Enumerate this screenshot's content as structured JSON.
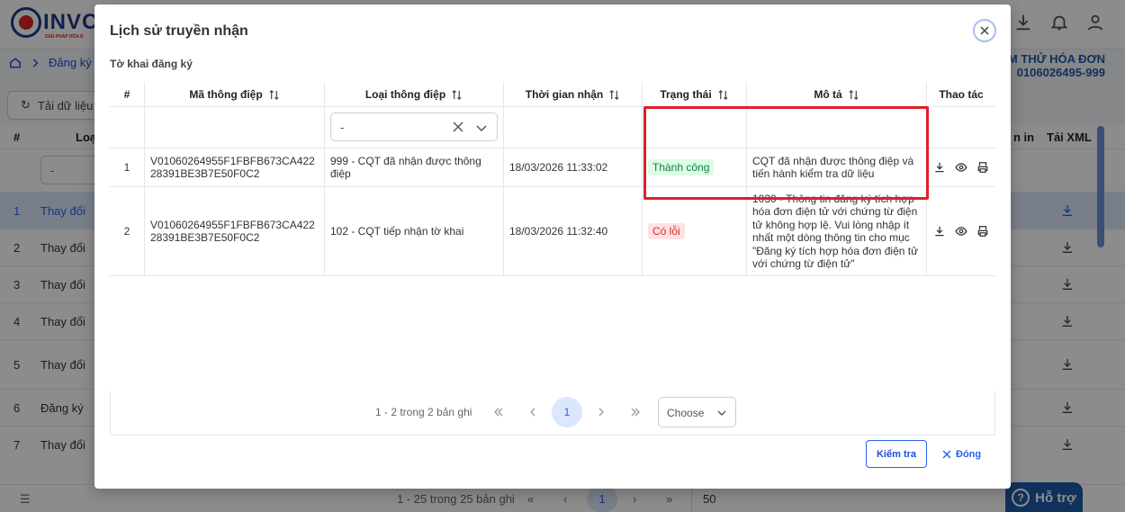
{
  "app": {
    "logo_text": "INVO",
    "logo_subtext": "GIẢI PHÁP HÓA Đ",
    "breadcrumb": "Đăng ký ph",
    "company_name": "ẾM THỬ HÓA ĐƠN",
    "company_tax": "0106026495-999",
    "reload_label": "Tải dữ liệu",
    "table_headers": {
      "index": "#",
      "type": "Loại",
      "receipt": "n in",
      "xml": "Tải XML"
    },
    "filter_placeholder": "-",
    "rows": [
      {
        "index": "1",
        "text": "Thay đổi"
      },
      {
        "index": "2",
        "text": "Thay đổi"
      },
      {
        "index": "3",
        "text": "Thay đổi"
      },
      {
        "index": "4",
        "text": "Thay đổi"
      },
      {
        "index": "5",
        "text": "Thay đổi"
      },
      {
        "index": "6",
        "text": "Đăng ký"
      },
      {
        "index": "7",
        "text": "Thay đổi"
      }
    ],
    "footer_info": "1 - 25 trong 25 bản ghi",
    "footer_page": "1",
    "footer_page_size": "50",
    "help_label": "Hỗ trợ"
  },
  "modal": {
    "title": "Lịch sử truyền nhận",
    "section_label": "Tờ khai đăng ký",
    "columns": [
      "#",
      "Mã thông điệp",
      "Loại thông điệp",
      "Thời gian nhận",
      "Trạng thái",
      "Mô tả",
      "Thao tác"
    ],
    "filter_select_value": "-",
    "rows": [
      {
        "index": "1",
        "message_id": "V01060264955F1FBFB673CA42228391BE3B7E50F0C2",
        "message_type": "999 - CQT đã nhận được thông điệp",
        "received_at": "18/03/2026 11:33:02",
        "status": "Thành công",
        "description": "CQT đã nhận được thông điệp và tiến hành kiểm tra dữ liệu"
      },
      {
        "index": "2",
        "message_id": "V01060264955F1FBFB673CA42228391BE3B7E50F0C2",
        "message_type": "102 - CQT tiếp nhận tờ khai",
        "received_at": "18/03/2026 11:32:40",
        "status": "Có lỗi",
        "description": "1030 - Thông tin đăng ký tích hợp hóa đơn điện tử với chứng từ điện tử không hợp lệ. Vui lòng nhập ít nhất một dòng thông tin cho mục \"Đăng ký tích hợp hóa đơn điện tử với chứng từ điện tử\""
      }
    ],
    "pager": {
      "info": "1 - 2 trong 2 bản ghi",
      "current_page": "1",
      "page_size_placeholder": "Choose"
    },
    "check_button": "Kiểm tra",
    "close_button": "Đóng"
  },
  "colors": {
    "primary": "#2563eb",
    "success_bg": "#dcfce7",
    "success_text": "#15803d",
    "error_bg": "#fde2e2",
    "error_text": "#dc2626",
    "highlight_border": "#e11d2a"
  }
}
